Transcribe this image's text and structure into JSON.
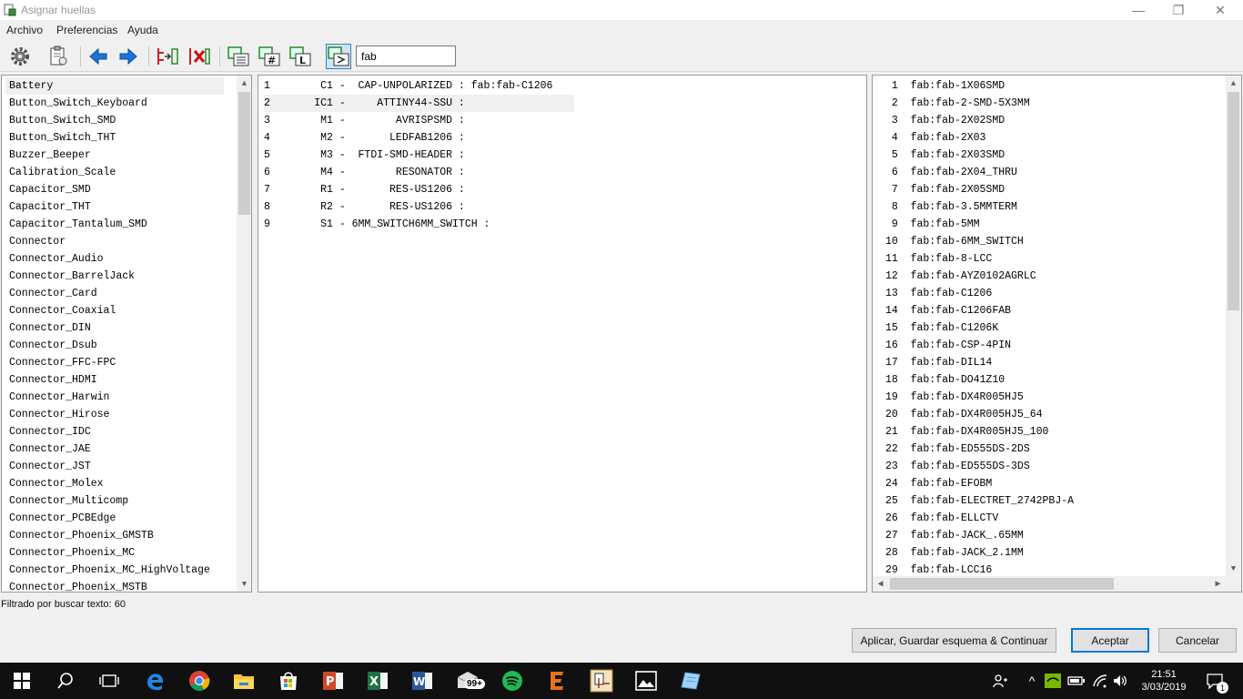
{
  "window": {
    "title": "Asignar huellas",
    "controls": {
      "minimize": "—",
      "restore": "❐",
      "close": "✕"
    }
  },
  "menu": [
    "Archivo",
    "Preferencias",
    "Ayuda"
  ],
  "toolbar": {
    "icons": [
      "gear-icon",
      "clipboard-icon",
      "arrow-left-icon",
      "arrow-right-icon",
      "auto-associate-icon",
      "delete-associations-icon",
      "filter-keyword-icon",
      "filter-pin-count-icon",
      "filter-library-icon",
      "filter-text-icon"
    ],
    "filter_value": "fab"
  },
  "libraries": {
    "selected": "Battery",
    "items": [
      "Battery",
      "Button_Switch_Keyboard",
      "Button_Switch_SMD",
      "Button_Switch_THT",
      "Buzzer_Beeper",
      "Calibration_Scale",
      "Capacitor_SMD",
      "Capacitor_THT",
      "Capacitor_Tantalum_SMD",
      "Connector",
      "Connector_Audio",
      "Connector_BarrelJack",
      "Connector_Card",
      "Connector_Coaxial",
      "Connector_DIN",
      "Connector_Dsub",
      "Connector_FFC-FPC",
      "Connector_HDMI",
      "Connector_Harwin",
      "Connector_Hirose",
      "Connector_IDC",
      "Connector_JAE",
      "Connector_JST",
      "Connector_Molex",
      "Connector_Multicomp",
      "Connector_PCBEdge",
      "Connector_Phoenix_GMSTB",
      "Connector_Phoenix_MC",
      "Connector_Phoenix_MC_HighVoltage",
      "Connector_Phoenix_MSTB"
    ]
  },
  "components": {
    "selected_index": 2,
    "rows": [
      "1        C1 -  CAP-UNPOLARIZED : fab:fab-C1206",
      "2       IC1 -     ATTINY44-SSU :",
      "3        M1 -        AVRISPSMD :",
      "4        M2 -       LEDFAB1206 :",
      "5        M3 -  FTDI-SMD-HEADER :",
      "6        M4 -        RESONATOR :",
      "7        R1 -       RES-US1206 :",
      "8        R2 -       RES-US1206 :",
      "9        S1 - 6MM_SWITCH6MM_SWITCH :"
    ]
  },
  "footprints": {
    "rows": [
      " 1  fab:fab-1X06SMD",
      " 2  fab:fab-2-SMD-5X3MM",
      " 3  fab:fab-2X02SMD",
      " 4  fab:fab-2X03",
      " 5  fab:fab-2X03SMD",
      " 6  fab:fab-2X04_THRU",
      " 7  fab:fab-2X05SMD",
      " 8  fab:fab-3.5MMTERM",
      " 9  fab:fab-5MM",
      "10  fab:fab-6MM_SWITCH",
      "11  fab:fab-8-LCC",
      "12  fab:fab-AYZ0102AGRLC",
      "13  fab:fab-C1206",
      "14  fab:fab-C1206FAB",
      "15  fab:fab-C1206K",
      "16  fab:fab-CSP-4PIN",
      "17  fab:fab-DIL14",
      "18  fab:fab-DO41Z10",
      "19  fab:fab-DX4R005HJ5",
      "20  fab:fab-DX4R005HJ5_64",
      "21  fab:fab-DX4R005HJ5_100",
      "22  fab:fab-ED555DS-2DS",
      "23  fab:fab-ED555DS-3DS",
      "24  fab:fab-EFOBM",
      "25  fab:fab-ELECTRET_2742PBJ-A",
      "26  fab:fab-ELLCTV",
      "27  fab:fab-JACK_.65MM",
      "28  fab:fab-JACK_2.1MM",
      "29  fab:fab-LCC16"
    ]
  },
  "status_text": "Filtrado por buscar texto: 60",
  "buttons": {
    "apply": "Aplicar, Guardar esquema & Continuar",
    "ok": "Aceptar",
    "cancel": "Cancelar"
  },
  "taskbar": {
    "apps": [
      "start-icon",
      "search-icon",
      "task-view-icon",
      "edge-icon",
      "chrome-icon",
      "file-explorer-icon",
      "store-icon",
      "powerpoint-icon",
      "excel-icon",
      "word-icon",
      "mail-icon",
      "spotify-icon",
      "app-e-icon",
      "kicad-icon",
      "photos-icon",
      "app-tile-icon"
    ],
    "mail_badge": "99+",
    "time": "21:51",
    "date": "3/03/2019",
    "notification_count": "1"
  },
  "colors": {
    "accent": "#0078d7",
    "taskbar": "#101010",
    "toolbar_arrows": "#1e73d8",
    "delete_red": "#cc1111"
  }
}
